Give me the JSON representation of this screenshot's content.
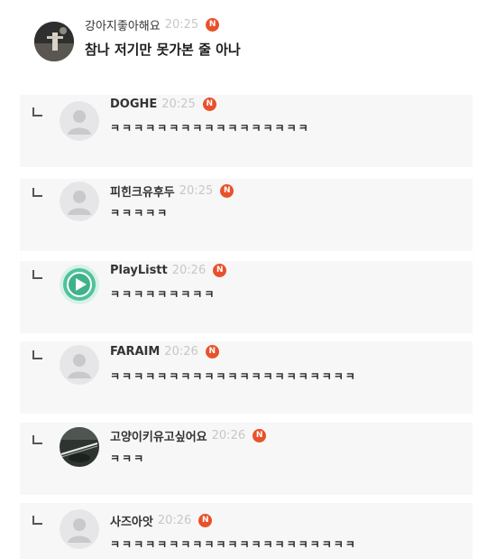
{
  "top_comment": {
    "nickname": "강아지좋아해요",
    "time": "20:25",
    "badge": "N",
    "text": "참나 저기만 못가본 줄 아나",
    "avatar_icon": "photo-avatar-icon"
  },
  "replies": [
    {
      "nickname": "DOGHE",
      "time": "20:25",
      "badge": "N",
      "text": "ㅋㅋㅋㅋㅋㅋㅋㅋㅋㅋㅋㅋㅋㅋㅋㅋㅋ",
      "avatar_icon": "default-user-icon"
    },
    {
      "nickname": "피힌크유후두",
      "time": "20:25",
      "badge": "N",
      "text": "ㅋㅋㅋㅋㅋ",
      "avatar_icon": "default-user-icon"
    },
    {
      "nickname": "PlayListt",
      "time": "20:26",
      "badge": "N",
      "text": "ㅋㅋㅋㅋㅋㅋㅋㅋㅋ",
      "avatar_icon": "play-icon"
    },
    {
      "nickname": "FARAIM",
      "time": "20:26",
      "badge": "N",
      "text": "ㅋㅋㅋㅋㅋㅋㅋㅋㅋㅋㅋㅋㅋㅋㅋㅋㅋㅋㅋㅋㅋ",
      "avatar_icon": "default-user-icon"
    },
    {
      "nickname": "고양이키유고싶어요",
      "time": "20:26",
      "badge": "N",
      "text": "ㅋㅋㅋ",
      "avatar_icon": "photo-avatar-icon"
    },
    {
      "nickname": "사즈아앗",
      "time": "20:26",
      "badge": "N",
      "text": "ㅋㅋㅋㅋㅋㅋㅋㅋㅋㅋㅋㅋㅋㅋㅋㅋㅋㅋㅋㅋㅋ",
      "avatar_icon": "default-user-icon"
    }
  ],
  "colors": {
    "badge": "#e8522b",
    "time": "#c7c7c7",
    "reply_background": "#f7f7f8",
    "play_avatar": "#4fc39a"
  }
}
